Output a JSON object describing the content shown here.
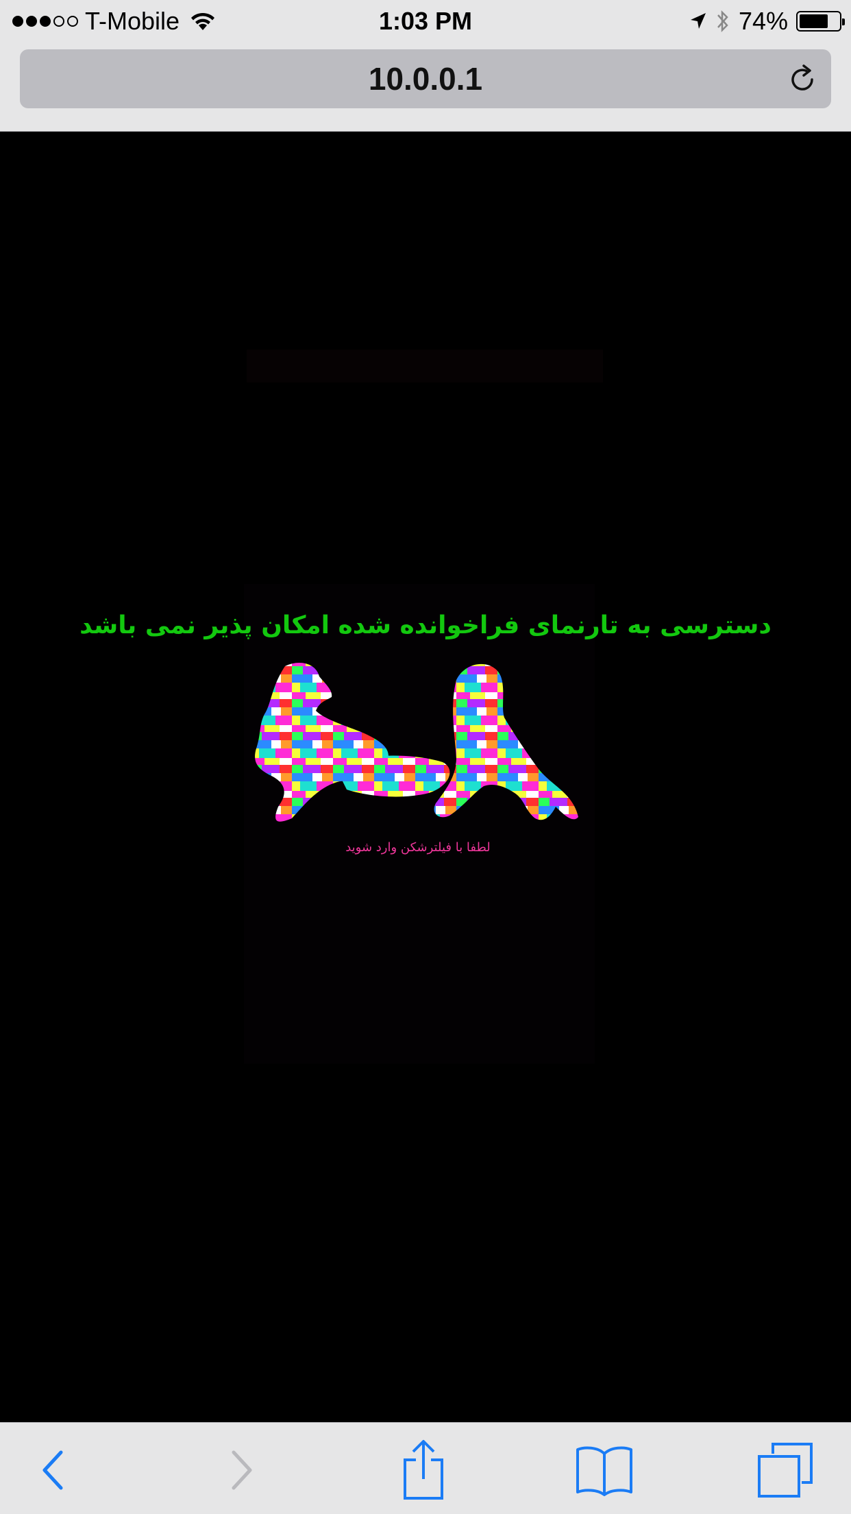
{
  "status_bar": {
    "carrier": "T-Mobile",
    "signal_bars_filled": 3,
    "signal_bars_total": 5,
    "time": "1:03 PM",
    "battery_percent": "74%",
    "battery_level": 0.74
  },
  "browser": {
    "url": "10.0.0.1"
  },
  "page": {
    "headline": "دسترسی به تارنمای فراخوانده شده امکان پذیر نمی باشد",
    "subline": "لطفا با فیلترشکن وارد شوید"
  },
  "colors": {
    "headline": "#13c80f",
    "subline": "#f0379b",
    "ios_blue": "#1b7cf5",
    "disabled": "#b9b9bd"
  },
  "icons": {
    "back": "chevron-left",
    "forward": "chevron-right",
    "share": "share-up-arrow",
    "bookmarks": "open-book",
    "tabs": "stacked-squares",
    "reload": "circular-arrow"
  }
}
